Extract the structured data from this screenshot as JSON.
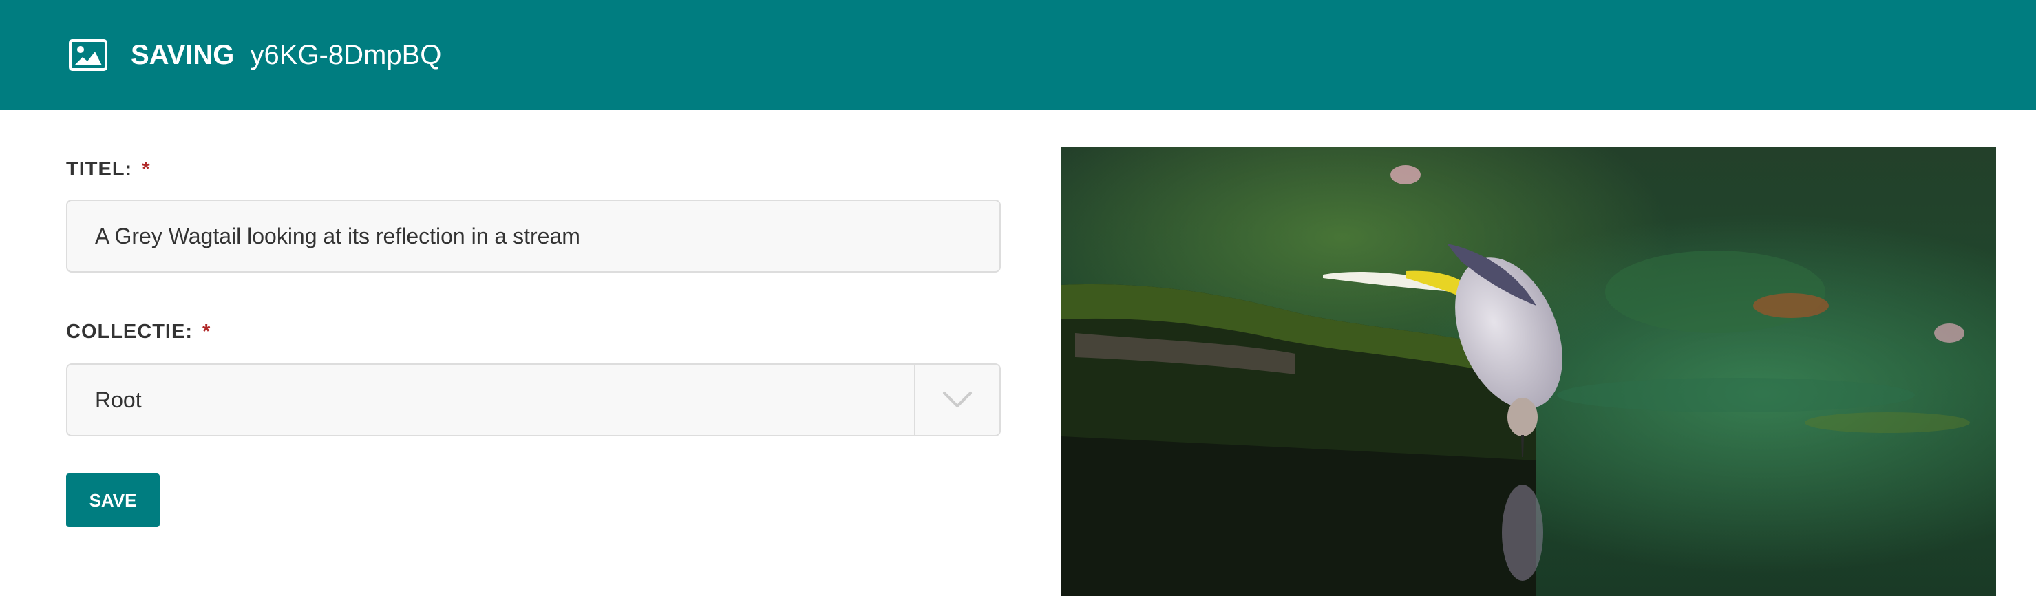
{
  "header": {
    "icon": "image-icon",
    "action": "SAVING",
    "item_id": "y6KG-8DmpBQ"
  },
  "form": {
    "title_label": "TITEL:",
    "title_required": "*",
    "title_value": "A Grey Wagtail looking at its reflection in a stream",
    "collection_label": "COLLECTIE:",
    "collection_required": "*",
    "collection_value": "Root",
    "save_label": "SAVE"
  },
  "colors": {
    "accent": "#007d80",
    "required": "#b02828",
    "field_background": "#f8f8f8",
    "field_border": "#dddddd"
  }
}
